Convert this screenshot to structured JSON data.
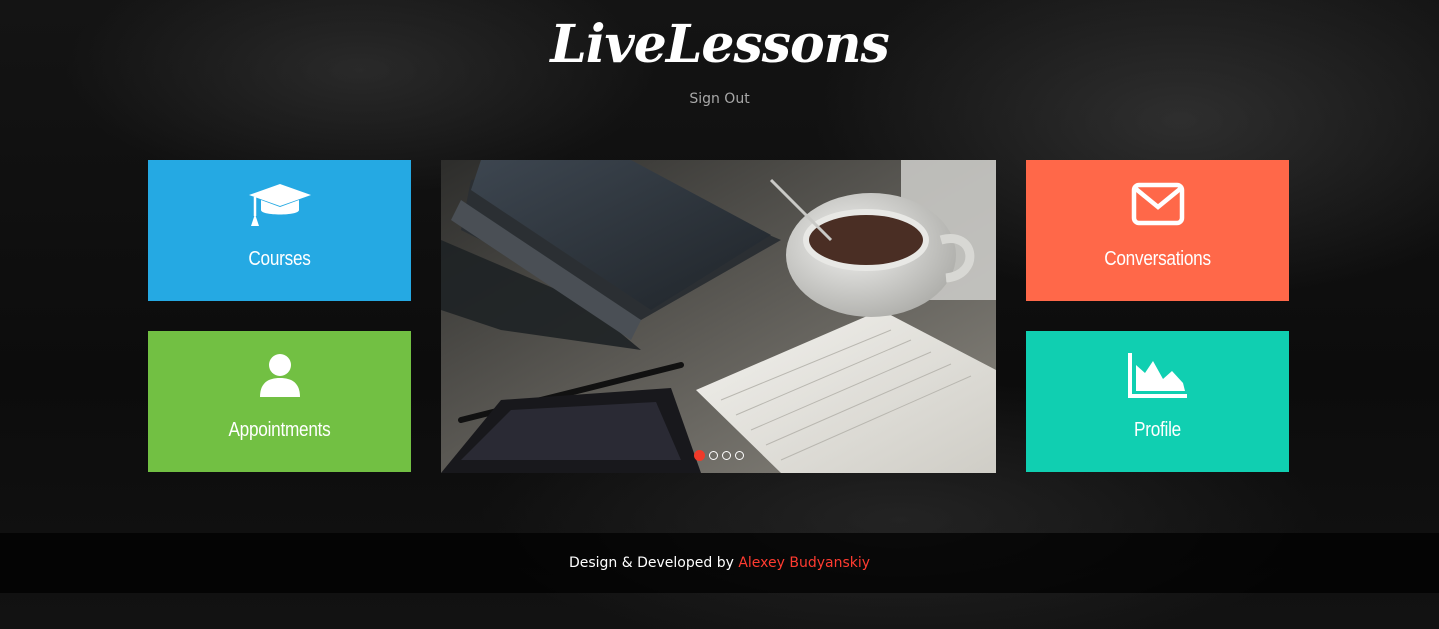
{
  "header": {
    "logo": "LiveLessons",
    "signout_label": "Sign Out"
  },
  "tiles": {
    "courses": {
      "label": "Courses",
      "icon": "graduation-cap-icon",
      "color": "#25a9e3"
    },
    "appointments": {
      "label": "Appointments",
      "icon": "user-icon",
      "color": "#72c043"
    },
    "conversations": {
      "label": "Conversations",
      "icon": "envelope-icon",
      "color": "#ff6849"
    },
    "profile": {
      "label": "Profile",
      "icon": "area-chart-icon",
      "color": "#10cfb1"
    }
  },
  "slider": {
    "slide_count": 4,
    "active_slide": 1,
    "active_dot_color": "#ef3b2a"
  },
  "footer": {
    "prefix": "Design & Developed by",
    "author": "Alexey Budyanskiy",
    "author_color": "#ff3b30"
  }
}
